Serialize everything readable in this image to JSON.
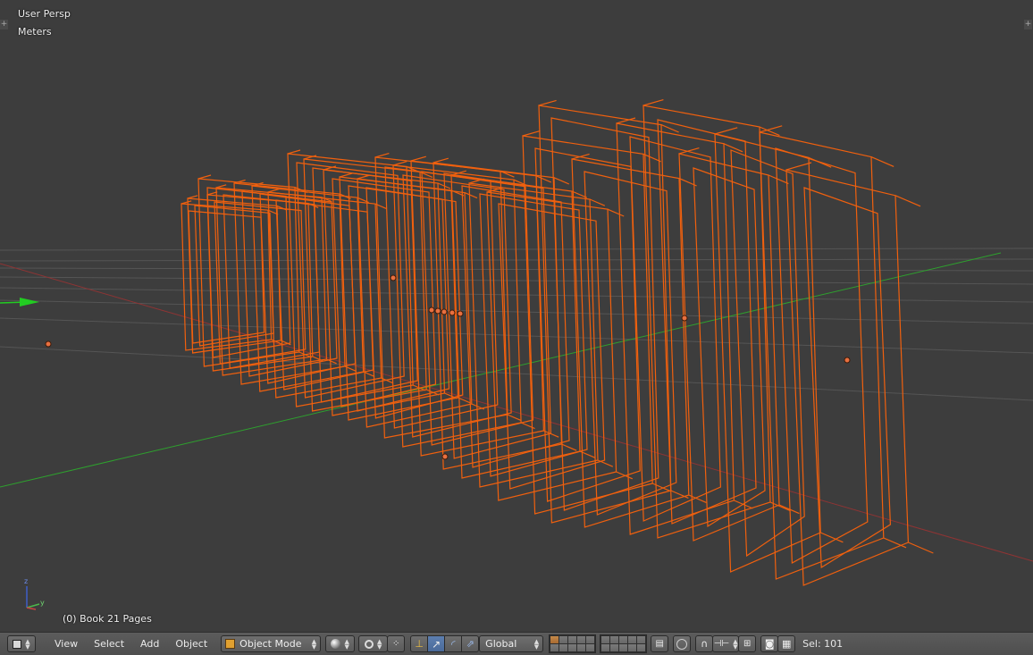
{
  "viewport": {
    "view_label": "User Persp",
    "units_label": "Meters",
    "object_info": "(0) Book 21 Pages",
    "axis_labels": {
      "z": "z",
      "y": "y"
    },
    "colors": {
      "background": "#3d3d3d",
      "selected_wire": "#f0600e",
      "x_axis": "#8e3434",
      "y_axis": "#2ea02e",
      "grid": "#555555"
    }
  },
  "header": {
    "editor_type_icon": "cube-icon",
    "menus": {
      "view": "View",
      "select": "Select",
      "add": "Add",
      "object": "Object"
    },
    "mode": "Object Mode",
    "viewport_shading_icon": "sphere-icon",
    "pivot_icon": "pivot-icon",
    "manipulator_icon": "manipulator-icon",
    "transform_orientation": "Global",
    "status": "Sel: 101"
  }
}
